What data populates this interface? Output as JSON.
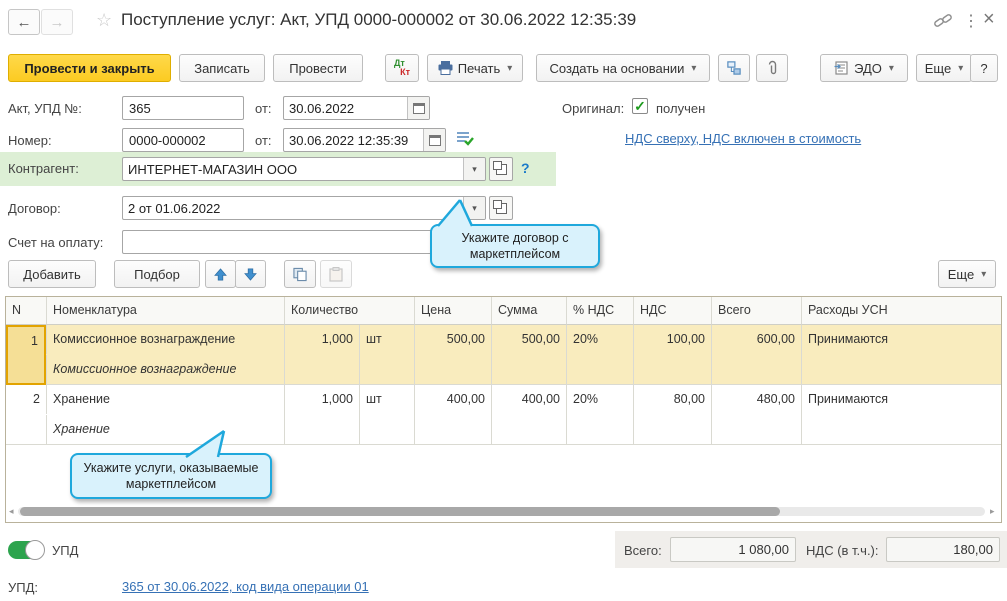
{
  "window": {
    "title": "Поступление услуг: Акт, УПД 0000-000002 от 30.06.2022 12:35:39",
    "close_glyph": "×",
    "more_glyph": "⋮",
    "back_glyph": "←",
    "forward_glyph": "→",
    "favorite_glyph": "☆"
  },
  "toolbar": {
    "post_and_close": "Провести и закрыть",
    "save": "Записать",
    "post": "Провести",
    "dtkt": {
      "dt": "Дт",
      "kt": "Кт"
    },
    "print": "Печать",
    "create_based_on": "Создать на основании",
    "edo": "ЭДО",
    "more": "Еще",
    "help": "?"
  },
  "form": {
    "act_no": {
      "label": "Акт, УПД №:",
      "value": "365",
      "from_label": "от:",
      "date": "30.06.2022"
    },
    "number": {
      "label": "Номер:",
      "value": "0000-000002",
      "from_label": "от:",
      "datetime": "30.06.2022 12:35:39"
    },
    "original": {
      "label": "Оригинал:",
      "checkbox_label": "получен",
      "checked": true,
      "check_glyph": "✓"
    },
    "vat_link": "НДС сверху, НДС включен в стоимость",
    "counterparty": {
      "label": "Контрагент:",
      "value": "ИНТЕРНЕТ-МАГАЗИН ООО",
      "help": "?"
    },
    "contract": {
      "label": "Договор:",
      "value": "2 от 01.06.2022"
    },
    "invoice": {
      "label": "Счет на оплату:",
      "value": "",
      "placeholder": ""
    }
  },
  "callouts": {
    "contract": "Укажите договор с маркетплейсом",
    "services": "Укажите услуги, оказываемые маркетплейсом"
  },
  "items_bar": {
    "add": "Добавить",
    "pick": "Подбор",
    "more": "Еще"
  },
  "table": {
    "columns": [
      "N",
      "Номенклатура",
      "Количество",
      "Цена",
      "Сумма",
      "% НДС",
      "НДС",
      "Всего",
      "Расходы УСН"
    ],
    "rows": [
      {
        "n": "1",
        "name": "Комиссионное вознаграждение",
        "name2": "Комиссионное вознаграждение",
        "qty": "1,000",
        "unit": "шт",
        "price": "500,00",
        "sum": "500,00",
        "vat_rate": "20%",
        "vat": "100,00",
        "total": "600,00",
        "usn": "Принимаются"
      },
      {
        "n": "2",
        "name": "Хранение",
        "name2": "Хранение",
        "qty": "1,000",
        "unit": "шт",
        "price": "400,00",
        "sum": "400,00",
        "vat_rate": "20%",
        "vat": "80,00",
        "total": "480,00",
        "usn": "Принимаются"
      }
    ]
  },
  "footer": {
    "upd_toggle_label": "УПД",
    "total_label": "Всего:",
    "total_value": "1 080,00",
    "vat_label": "НДС (в т.ч.):",
    "vat_value": "180,00",
    "upd_label": "УПД:",
    "upd_link": "365 от 30.06.2022, код вида операции 01"
  },
  "icons": {
    "back": "back-arrow",
    "forward": "forward-arrow",
    "favorite": "star-outline",
    "link": "chain-link",
    "more": "vertical-ellipsis",
    "close": "close-x",
    "print": "printer",
    "dtkt": "debit-credit",
    "structure": "related-documents",
    "attach": "paperclip",
    "edo": "edo-document",
    "calendar": "calendar",
    "open": "open-form",
    "dropdown": "caret-down",
    "copy": "copy",
    "paste": "paste",
    "move_up": "arrow-up-blue",
    "move_down": "arrow-down-blue",
    "filled_check": "list-with-green-check"
  },
  "colors": {
    "accent_button": "#fccb22",
    "counterparty_highlight": "#ddefd5",
    "selected_row": "#f9ecbe",
    "selected_cell": "#f5df96",
    "selected_cell_border": "#e2a300",
    "link": "#3671b5",
    "callout_bg": "#d9f2fc",
    "callout_border": "#1fa8dc",
    "toggle_on": "#2da44e"
  }
}
